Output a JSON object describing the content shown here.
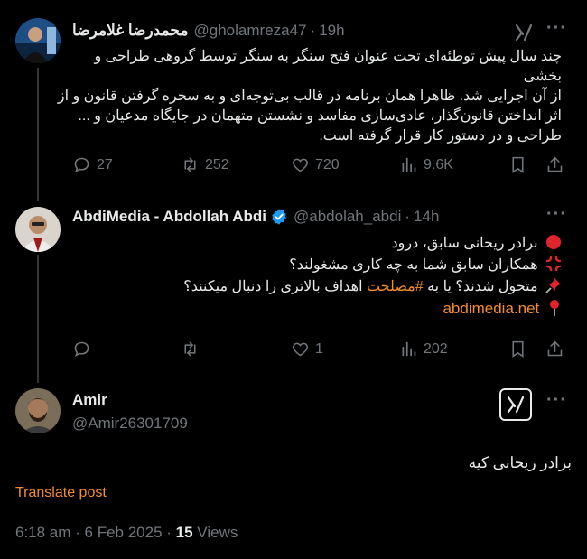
{
  "tweet1": {
    "name": "محمدرضا غلامرضا",
    "handle": "@gholamreza47",
    "time": "19h",
    "lines": [
      "چند سال پیش توطئه‌ای تحت عنوان فتح سنگر به سنگر توسط گروهی طراحی و بخشی",
      "از آن اجرایی شد. ظاهرا همان برنامه در قالب بی‌توجه‌ای و به سخره گرفتن قانون و از",
      "اثر انداختن قانون‌گذار، عادی‌سازی مفاسد و نشستن متهمان در جایگاه مدعیان و ...",
      "طراحی و در دستور کار قرار گرفته است."
    ],
    "replies": "27",
    "reposts": "252",
    "likes": "720",
    "views": "9.6K"
  },
  "tweet2": {
    "name": "AbdiMedia - Abdollah Abdi",
    "handle": "@abdolah_abdi",
    "time": "14h",
    "line1": "برادر ریحانی سابق، درود",
    "line2": "همکاران سابق شما به چه کاری مشغولند؟",
    "line3_pre": "متحول شدند؟ یا به ",
    "hashtag": "#مصلحت",
    "line3_post": " اهداف بالاتری را دنبال میکنند؟",
    "link": "abdimedia.net",
    "likes": "1",
    "views": "202"
  },
  "tweet3": {
    "name": "Amir",
    "handle": "@Amir26301709",
    "text": "برادر ریحانی کیه",
    "translate": "Translate post",
    "timestamp": "6:18 am · 6 Feb 2025 · ",
    "views_count": "15",
    "views_label": " Views"
  },
  "icons": {
    "reply": "reply-icon",
    "repost": "repost-icon",
    "like": "heart-icon",
    "views": "views-icon",
    "bookmark": "bookmark-icon",
    "share": "share-icon",
    "grok": "grok-icon",
    "more": "more-icon",
    "verified": "verified-badge-icon"
  },
  "colors": {
    "background": "#000000",
    "text": "#e7e9ea",
    "muted": "#71767b",
    "accent": "#f48c2c",
    "verified": "#1d9bf0"
  }
}
